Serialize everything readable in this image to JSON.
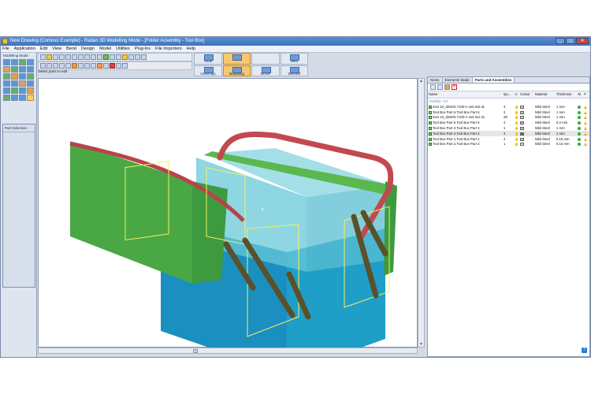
{
  "window": {
    "title": "New Drawing (Contoso Example) - Radan 3D Modelling Mode - [Folder Assembly - Tool Box]",
    "minimize": "_",
    "maximize": "□",
    "close": "✕"
  },
  "menu": [
    "File",
    "Application",
    "Edit",
    "View",
    "Bend",
    "Design",
    "Model",
    "Utilities",
    "Plug-Ins",
    "File Importers",
    "Help"
  ],
  "status_prompt": "Select parts to edit",
  "big_tools": [
    {
      "label": "Tools",
      "active": false
    },
    {
      "label": "",
      "active": true
    },
    {
      "label": "",
      "active": false
    },
    {
      "label": "Nest",
      "active": false
    },
    {
      "label": "Assembly",
      "active": false
    },
    {
      "label": "Modelling",
      "active": true
    },
    {
      "label": "Drone",
      "active": false
    },
    {
      "label": "Defined",
      "active": false
    }
  ],
  "left_panel": {
    "mode_label": "Modelling Mode",
    "part_selection_label": "Part Selection"
  },
  "right_panel": {
    "tabs": [
      "Nests",
      "Elements Made",
      "Parts and Assemblies"
    ],
    "active_tab": "Parts and Assemblies",
    "columns": [
      "Name",
      "Qu...",
      "V",
      "Colour",
      "Material",
      "Thickness",
      "M",
      "F"
    ],
    "group_label": "Visibility: Yes",
    "rows": [
      {
        "name": "rivet 10_dinDIN 7340-A 4x0.3x5 3L",
        "qty": "4",
        "colour": "#c9c9c9",
        "material": "Mild Steel",
        "thickness": "1 mm",
        "warn": true
      },
      {
        "name": "Tool Box Part 6.Tool Box Part 6",
        "qty": "2",
        "colour": "#a8d6a0",
        "material": "Mild Steel",
        "thickness": "1 mm",
        "warn": true
      },
      {
        "name": "rivet 10_dinDIN 7340-A 4x0.3x4 2L",
        "qty": "28",
        "colour": "#c9c9c9",
        "material": "Mild Steel",
        "thickness": "1 mm",
        "warn": true
      },
      {
        "name": "Tool Box Part 5.Tool Box Part 5",
        "qty": "2",
        "colour": "#e8a0a8",
        "material": "Mild Steel",
        "thickness": "0.2 mm",
        "warn": true
      },
      {
        "name": "Tool Box Part 3.Tool Box Part 3",
        "qty": "1",
        "colour": "#8ad89a",
        "material": "Mild Steel",
        "thickness": "1 mm",
        "warn": true
      },
      {
        "name": "Tool Box Part 4.Tool Box Part 4",
        "qty": "4",
        "colour": "#6d6a3a",
        "material": "Mild Steel",
        "thickness": "1 mm",
        "warn": true
      },
      {
        "name": "Tool Box Part 1.Tool Box Part 1",
        "qty": "4",
        "colour": "#7fd8e8",
        "material": "Mild Steel",
        "thickness": "0.15 mm",
        "warn": true
      },
      {
        "name": "Tool Box Part 2.Tool Box Part 2",
        "qty": "1",
        "colour": "#bfe0f0",
        "material": "Mild Steel",
        "thickness": "0.15 mm",
        "warn": true
      }
    ]
  },
  "scene": {
    "colors": {
      "box_blue": "#1f9ec8",
      "box_light": "#68c8d8",
      "lid_green": "#4caf4f",
      "handle_red": "#c2494f",
      "latch_olive": "#5a5129",
      "selection_yellow": "#f4f05a"
    },
    "axis_label": "Y"
  }
}
